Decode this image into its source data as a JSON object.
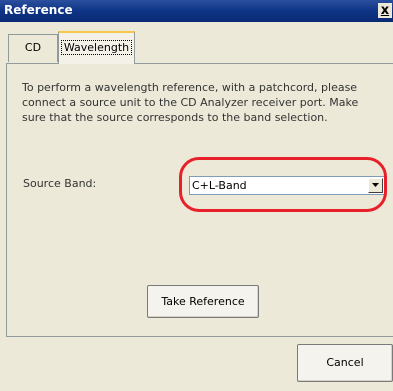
{
  "window": {
    "title": "Reference",
    "close_glyph": "x"
  },
  "tabs": [
    {
      "label": "CD",
      "active": false
    },
    {
      "label": "Wavelength",
      "active": true
    }
  ],
  "panel": {
    "instructions": "To perform a wavelength reference, with a patchcord,  please connect a source unit to the CD Analyzer receiver port. Make sure that the source corresponds to the band selection.",
    "source_band_label": "Source Band:",
    "source_band_value": "C+L-Band",
    "take_reference_label": "Take Reference"
  },
  "footer": {
    "cancel_label": "Cancel"
  },
  "colors": {
    "highlight": "#e8202a",
    "titlebar": "#0e3486",
    "active_tab_accent": "#f5c74a"
  }
}
